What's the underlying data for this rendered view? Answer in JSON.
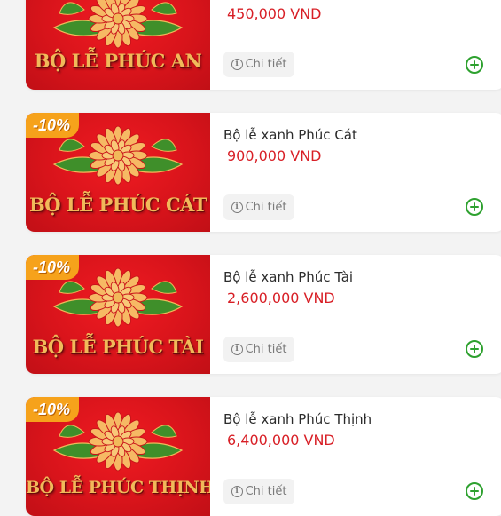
{
  "products": [
    {
      "thumb_title": "BỘ LỄ PHÚC AN",
      "name": "",
      "price": "450,000 VND",
      "discount": "",
      "detail_label": "Chi tiết"
    },
    {
      "thumb_title": "BỘ LỄ PHÚC CÁT",
      "name": "Bộ lễ xanh Phúc Cát",
      "price": "900,000 VND",
      "discount": "-10%",
      "detail_label": "Chi tiết"
    },
    {
      "thumb_title": "BỘ LỄ PHÚC TÀI",
      "name": "Bộ lễ xanh Phúc Tài",
      "price": "2,600,000 VND",
      "discount": "-10%",
      "detail_label": "Chi tiết"
    },
    {
      "thumb_title": "BỘ LỄ PHÚC THỊNH",
      "name": "Bộ lễ xanh Phúc Thịnh",
      "price": "6,400,000 VND",
      "discount": "-10%",
      "detail_label": "Chi tiết"
    }
  ],
  "icons": {
    "info": "info-icon",
    "add": "plus-circle-icon",
    "flower": "chrysanthemum-icon"
  },
  "colors": {
    "price": "#d81f26",
    "thumb_red": "#d9141b",
    "thumb_gold": "#f1b95a",
    "discount_badge": "#f6a21b",
    "add_green": "#2ea12f"
  }
}
